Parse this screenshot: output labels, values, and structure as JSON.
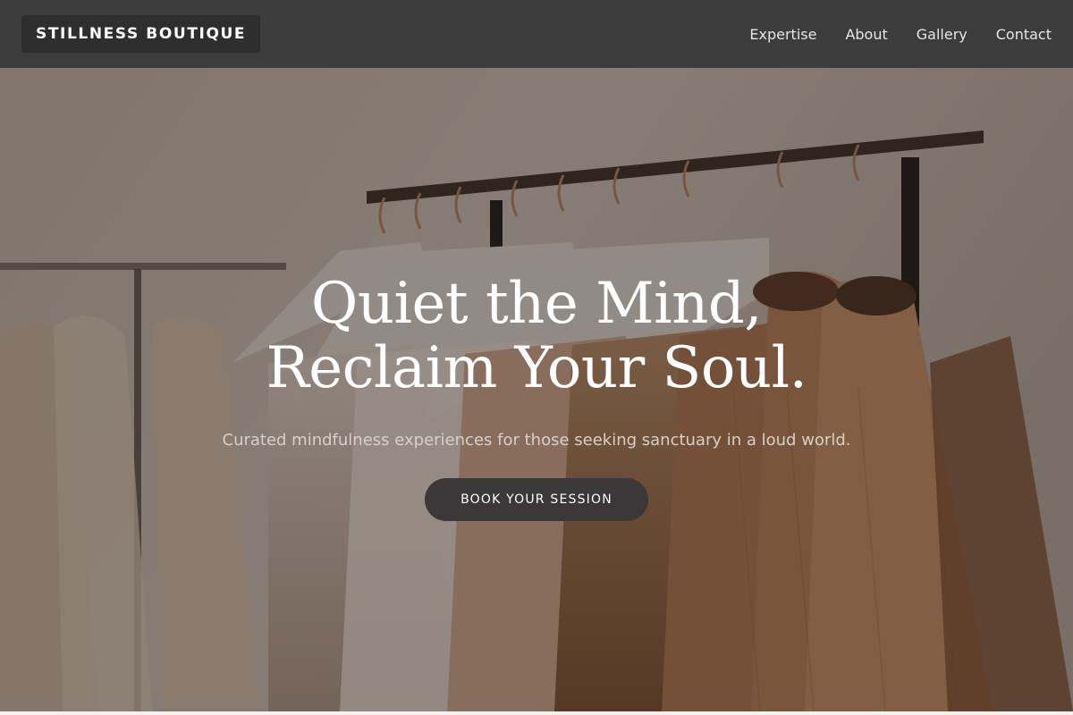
{
  "header": {
    "brand": "STILLNESS BOUTIQUE",
    "nav": [
      {
        "label": "Expertise"
      },
      {
        "label": "About"
      },
      {
        "label": "Gallery"
      },
      {
        "label": "Contact"
      }
    ]
  },
  "hero": {
    "title_line1": "Quiet the Mind,",
    "title_line2": "Reclaim Your Soul.",
    "subtitle": "Curated mindfulness experiences for those seeking sanctuary in a loud world.",
    "cta_label": "BOOK YOUR SESSION",
    "background_image": "photo-clothing-rack-icon"
  },
  "colors": {
    "header_bg": "#3c3c3c",
    "brand_bg": "#2e2e2e",
    "cta_bg": "#3a3838",
    "page_bg": "#f4f1ee"
  }
}
